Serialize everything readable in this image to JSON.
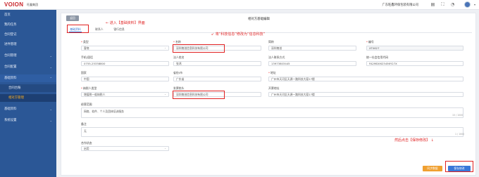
{
  "header": {
    "logo": "VOION",
    "logo_sub": "旺鑫集团",
    "company": "广东旺鑫环保包装有限公司",
    "icons": [
      "document-icon",
      "fullscreen-icon",
      "bell-icon"
    ]
  },
  "sidebar": {
    "items": [
      {
        "label": "首页"
      },
      {
        "label": "我的任务"
      },
      {
        "label": "合同登记"
      },
      {
        "label": "进件管理"
      },
      {
        "label": "合同管理",
        "has_arrow": true
      },
      {
        "label": "合同配置",
        "has_arrow": true
      },
      {
        "label": "基础资料",
        "has_arrow": true
      },
      {
        "label": "合同台账",
        "sub": true
      },
      {
        "label": "相对方管理",
        "sub": true,
        "active": true
      },
      {
        "label": "基础资料",
        "has_arrow": true
      },
      {
        "label": "系统设置",
        "has_arrow": true
      }
    ]
  },
  "page": {
    "back_label": "返回",
    "title": "相对方基础编辑"
  },
  "tabs": [
    {
      "label": "基础资料",
      "active": true
    },
    {
      "label": "联系人"
    },
    {
      "label": "银行信息"
    }
  ],
  "form": {
    "category": {
      "label": "类型",
      "value": "客商"
    },
    "name": {
      "label": "名称",
      "value": "深圳南创信息科技有限公司"
    },
    "abbr": {
      "label": "简称",
      "value": "深圳南创"
    },
    "code": {
      "label": "编号",
      "value": "XT0627"
    },
    "phone": {
      "label": "手机/固话",
      "value": "0755-25338800"
    },
    "legal_person": {
      "label": "法人姓名",
      "value": "张鸿"
    },
    "legal_contact": {
      "label": "法人联系方式",
      "value": "13973803445"
    },
    "credit_code": {
      "label": "统一社会信用代码",
      "value": "FA2MD0623456Y27X"
    },
    "country": {
      "label": "国家",
      "value": "中国"
    },
    "province": {
      "label": "省份/市",
      "value": "广东省"
    },
    "address": {
      "label": "地址",
      "value": "广州市天河区天源一路科技大厦27楼"
    },
    "taxpayer_type": {
      "label": "纳税人类型",
      "value": "增值税一般纳税人"
    },
    "invoice_title": {
      "label": "发票抬头",
      "value": "深圳南创信息科技有限公司"
    },
    "invoice_address": {
      "label": "开票地址",
      "value": "广州市天河区天源一路科技大厦27楼"
    },
    "business_scope": {
      "label": "经营范围",
      "value": "网络、软件、个人及团体培训服务",
      "count": "15 / 1000"
    },
    "remark": {
      "label": "备注",
      "value": "无",
      "count": "1 / 1000"
    },
    "partner_status": {
      "label": "合作状态",
      "value": "启用"
    }
  },
  "annotations": {
    "enter_tab": "进入【基础资料】界面",
    "rename": "将“科技信息”修改为“信息科技”",
    "save_hint": "然后点击【保存修改】"
  },
  "buttons": {
    "sync": "同步数据",
    "save": "保存修改"
  },
  "colors": {
    "sidebar": "#2b5796",
    "accent": "#2d6fd2",
    "annotation": "#e02020",
    "sync_button": "#f0a030"
  }
}
